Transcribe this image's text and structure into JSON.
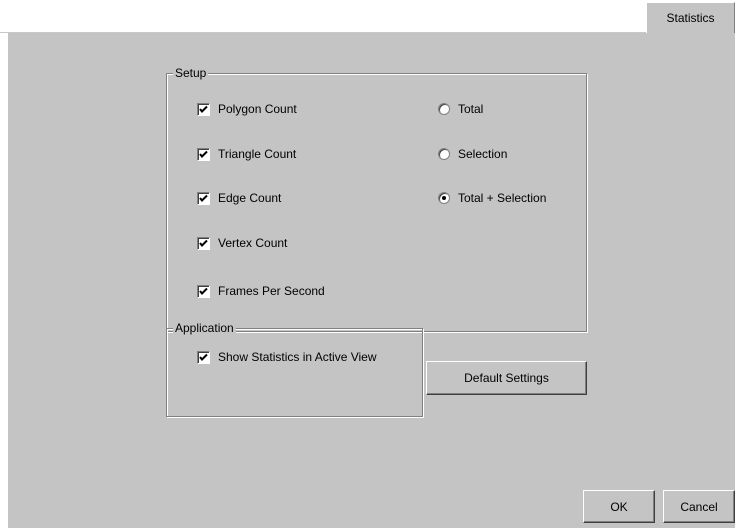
{
  "tabs": [
    {
      "label": "Statistics",
      "active": true
    }
  ],
  "setup": {
    "title": "Setup",
    "checkboxes": [
      {
        "label": "Polygon Count",
        "checked": true
      },
      {
        "label": "Triangle Count",
        "checked": true
      },
      {
        "label": "Edge Count",
        "checked": true
      },
      {
        "label": "Vertex Count",
        "checked": true
      },
      {
        "label": "Frames Per Second",
        "checked": true
      }
    ],
    "radios": [
      {
        "label": "Total",
        "selected": false
      },
      {
        "label": "Selection",
        "selected": false
      },
      {
        "label": "Total + Selection",
        "selected": true
      }
    ]
  },
  "application": {
    "title": "Application",
    "show_stats": {
      "label": "Show Statistics in Active View",
      "checked": true
    }
  },
  "buttons": {
    "default_settings": "Default Settings",
    "ok": "OK",
    "cancel": "Cancel"
  },
  "colors": {
    "panel_bg": "#c4c4c4",
    "page_bg": "#ffffff"
  },
  "icons": {
    "check": "checkmark-icon",
    "radio_dot": "radio-dot-icon"
  }
}
